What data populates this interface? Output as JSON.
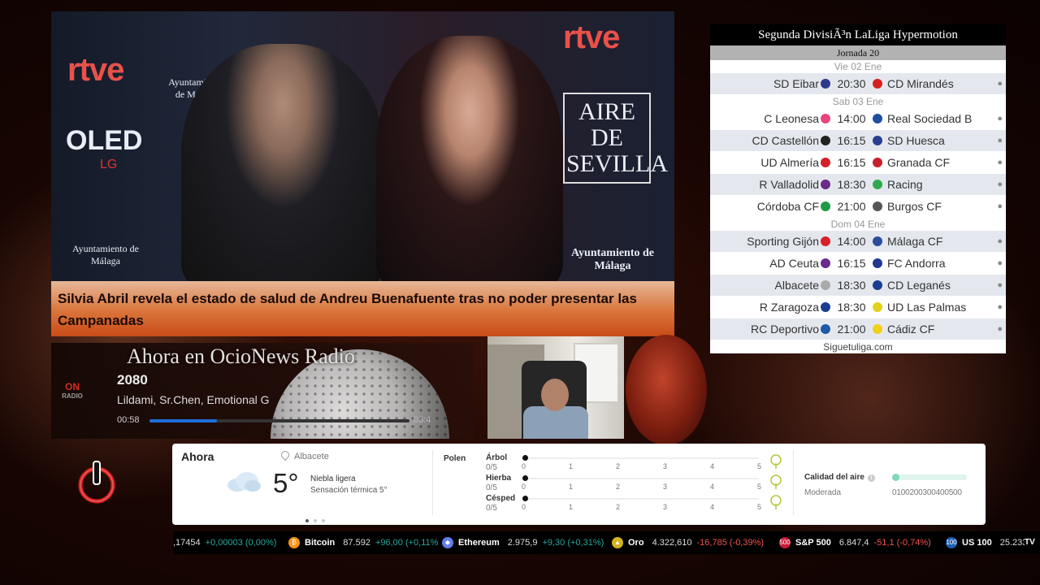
{
  "news": {
    "headline": "Silvia Abril revela el estado de salud de Andreu Buenafuente tras no poder presentar las Campanadas",
    "backdrop_logos": {
      "rtve": "rtve",
      "oled": "OLED",
      "lg": "LG",
      "aire_de_sevilla": "AIRE DE SEVILLA",
      "ayuntamiento": "Ayuntamiento de Málaga"
    }
  },
  "liga": {
    "title": "Segunda DivisiÃ³n LaLiga Hypermotion",
    "jornada": "Jornada 20",
    "days": [
      {
        "date": "Vie 02 Ene",
        "matches": [
          {
            "home": "SD Eibar",
            "time": "20:30",
            "away": "CD Mirandés",
            "home_color": "#2d3a8c",
            "away_color": "#d62020"
          }
        ]
      },
      {
        "date": "Sab 03 Ene",
        "matches": [
          {
            "home": "C Leonesa",
            "time": "14:00",
            "away": "Real Sociedad B",
            "home_color": "#e8457a",
            "away_color": "#1d4fa0"
          },
          {
            "home": "CD Castellón",
            "time": "16:15",
            "away": "SD Huesca",
            "home_color": "#222222",
            "away_color": "#2b3f8f"
          },
          {
            "home": "UD Almería",
            "time": "16:15",
            "away": "Granada CF",
            "home_color": "#d4202a",
            "away_color": "#c8202e"
          },
          {
            "home": "R Valladolid",
            "time": "18:30",
            "away": "Racing",
            "home_color": "#6a2b8c",
            "away_color": "#2fa84f"
          },
          {
            "home": "Córdoba CF",
            "time": "21:00",
            "away": "Burgos CF",
            "home_color": "#1e9a45",
            "away_color": "#555555"
          }
        ]
      },
      {
        "date": "Dom 04 Ene",
        "matches": [
          {
            "home": "Sporting Gijón",
            "time": "14:00",
            "away": "Málaga CF",
            "home_color": "#d62027",
            "away_color": "#2a4d9c"
          },
          {
            "home": "AD Ceuta",
            "time": "16:15",
            "away": "FC Andorra",
            "home_color": "#6b2a8e",
            "away_color": "#213a8f"
          },
          {
            "home": "Albacete",
            "time": "18:30",
            "away": "CD Leganés",
            "home_color": "#aaaaaa",
            "away_color": "#1b3d8f"
          },
          {
            "home": "R Zaragoza",
            "time": "18:30",
            "away": "UD Las Palmas",
            "home_color": "#1b3d8f",
            "away_color": "#e2d01a"
          },
          {
            "home": "RC Deportivo",
            "time": "21:00",
            "away": "Cádiz CF",
            "home_color": "#1d5aa8",
            "away_color": "#f2d017"
          }
        ]
      }
    ],
    "footer": "Siguetuliga.com"
  },
  "radio": {
    "heading": "Ahora en OcioNews Radio",
    "logo_text": "ON",
    "logo_sub": "RADIO",
    "track": "2080",
    "artist": "Lildami, Sr.Chen, Emotional G",
    "current_time": "00:58",
    "duration": "03:4",
    "progress": 0.26
  },
  "weather": {
    "now_label": "Ahora",
    "location": "Albacete",
    "temperature": "5°",
    "condition": "Niebla ligera",
    "feels_like": "Sensación térmica 5°",
    "pollen_label": "Polen",
    "pollen": [
      {
        "name": "Árbol",
        "value": "0/5",
        "level": 0
      },
      {
        "name": "Hierba",
        "value": "0/5",
        "level": 0
      },
      {
        "name": "Césped",
        "value": "0/5",
        "level": 0
      }
    ],
    "pollen_scale": [
      "0",
      "1",
      "2",
      "3",
      "4",
      "5"
    ],
    "air_quality_label": "Calidad del aire",
    "air_quality_status": "Moderada",
    "air_quality_scale": "0100200300400500"
  },
  "ticker": [
    {
      "name": "",
      "price": ",17454",
      "change": "+0,00003 (0,00%)",
      "dir": "up",
      "icon": "",
      "color": ""
    },
    {
      "name": "Bitcoin",
      "price": "87.592",
      "change": "+96,00 (+0,11%",
      "dir": "up",
      "icon": "₿",
      "color": "#f7931a"
    },
    {
      "name": "Ethereum",
      "price": "2.975,9",
      "change": "+9,30 (+0,31%)",
      "dir": "up",
      "icon": "◆",
      "color": "#627eea"
    },
    {
      "name": "Oro",
      "price": "4.322,610",
      "change": "-16,785 (-0,39%)",
      "dir": "down",
      "icon": "▲",
      "color": "#d4b320"
    },
    {
      "name": "S&P 500",
      "price": "6.847,4",
      "change": "-51,1 (-0,74%)",
      "dir": "down",
      "icon": "500",
      "color": "#cc1a3a"
    },
    {
      "name": "US 100",
      "price": "25.233",
      "change": "",
      "dir": "up",
      "icon": "100",
      "color": "#1e5fb4"
    }
  ],
  "ticker_brand": "TV"
}
